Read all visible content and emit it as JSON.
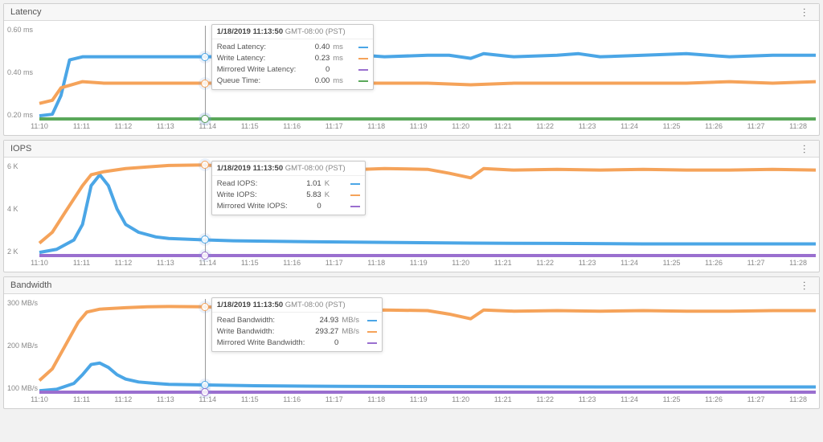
{
  "timestamp": {
    "bold": "1/18/2019 11:13:50",
    "tz": "GMT-08:00 (PST)"
  },
  "x_ticks": [
    "11:10",
    "11:11",
    "11:12",
    "11:13",
    "11:14",
    "11:15",
    "11:16",
    "11:17",
    "11:18",
    "11:19",
    "11:20",
    "11:21",
    "11:22",
    "11:23",
    "11:24",
    "11:25",
    "11:26",
    "11:27",
    "11:28"
  ],
  "cursor": {
    "minute": 13.833,
    "range_start": 10,
    "range_end": 28
  },
  "panels": {
    "latency": {
      "title": "Latency",
      "y_ticks": [
        "0.60 ms",
        "0.40 ms",
        "0.20 ms"
      ],
      "tooltip_rows": [
        {
          "label": "Read Latency:",
          "value": "0.40",
          "unit": "ms",
          "color": "#4ba6e6"
        },
        {
          "label": "Write Latency:",
          "value": "0.23",
          "unit": "ms",
          "color": "#f5a35a"
        },
        {
          "label": "Mirrored Write Latency:",
          "value": "0",
          "unit": "",
          "color": "#9a6fcf"
        },
        {
          "label": "Queue Time:",
          "value": "0.00",
          "unit": "ms",
          "color": "#5aa85a"
        }
      ]
    },
    "iops": {
      "title": "IOPS",
      "y_ticks": [
        "6 K",
        "4 K",
        "2 K"
      ],
      "tooltip_rows": [
        {
          "label": "Read IOPS:",
          "value": "1.01",
          "unit": "K",
          "color": "#4ba6e6"
        },
        {
          "label": "Write IOPS:",
          "value": "5.83",
          "unit": "K",
          "color": "#f5a35a"
        },
        {
          "label": "Mirrored Write IOPS:",
          "value": "0",
          "unit": "",
          "color": "#9a6fcf"
        }
      ]
    },
    "bandwidth": {
      "title": "Bandwidth",
      "y_ticks": [
        "300 MB/s",
        "200 MB/s",
        "100 MB/s"
      ],
      "tooltip_rows": [
        {
          "label": "Read Bandwidth:",
          "value": "24.93",
          "unit": "MB/s",
          "color": "#4ba6e6"
        },
        {
          "label": "Write Bandwidth:",
          "value": "293.27",
          "unit": "MB/s",
          "color": "#f5a35a"
        },
        {
          "label": "Mirrored Write Bandwidth:",
          "value": "0",
          "unit": "",
          "color": "#9a6fcf"
        }
      ]
    }
  },
  "chart_data": [
    {
      "title": "Latency",
      "type": "line",
      "x_range": [
        10,
        28
      ],
      "y_range": [
        0,
        0.6
      ],
      "y_unit": "ms",
      "series": [
        {
          "name": "Read Latency",
          "color": "#4ba6e6",
          "values": [
            [
              10,
              0.02
            ],
            [
              10.3,
              0.03
            ],
            [
              10.5,
              0.15
            ],
            [
              10.7,
              0.38
            ],
            [
              11,
              0.4
            ],
            [
              11.5,
              0.4
            ],
            [
              12,
              0.4
            ],
            [
              13,
              0.4
            ],
            [
              13.83,
              0.4
            ],
            [
              14,
              0.4
            ],
            [
              15,
              0.4
            ],
            [
              16,
              0.4
            ],
            [
              17,
              0.4
            ],
            [
              17.5,
              0.41
            ],
            [
              18,
              0.4
            ],
            [
              19,
              0.41
            ],
            [
              19.5,
              0.41
            ],
            [
              20,
              0.39
            ],
            [
              20.3,
              0.42
            ],
            [
              21,
              0.4
            ],
            [
              22,
              0.41
            ],
            [
              22.5,
              0.42
            ],
            [
              23,
              0.4
            ],
            [
              24,
              0.41
            ],
            [
              25,
              0.42
            ],
            [
              26,
              0.4
            ],
            [
              27,
              0.41
            ],
            [
              28,
              0.41
            ]
          ]
        },
        {
          "name": "Write Latency",
          "color": "#f5a35a",
          "values": [
            [
              10,
              0.1
            ],
            [
              10.3,
              0.12
            ],
            [
              10.5,
              0.2
            ],
            [
              11,
              0.24
            ],
            [
              11.5,
              0.23
            ],
            [
              12,
              0.23
            ],
            [
              13,
              0.23
            ],
            [
              13.83,
              0.23
            ],
            [
              15,
              0.23
            ],
            [
              17,
              0.23
            ],
            [
              19,
              0.23
            ],
            [
              20,
              0.22
            ],
            [
              21,
              0.23
            ],
            [
              23,
              0.23
            ],
            [
              25,
              0.23
            ],
            [
              26,
              0.24
            ],
            [
              27,
              0.23
            ],
            [
              28,
              0.24
            ]
          ]
        },
        {
          "name": "Mirrored Write Latency",
          "color": "#9a6fcf",
          "values": [
            [
              10,
              0
            ],
            [
              28,
              0
            ]
          ]
        },
        {
          "name": "Queue Time",
          "color": "#5aa85a",
          "values": [
            [
              10,
              0
            ],
            [
              28,
              0
            ]
          ]
        }
      ]
    },
    {
      "title": "IOPS",
      "type": "line",
      "x_range": [
        10,
        28
      ],
      "y_range": [
        0,
        6
      ],
      "y_unit": "K",
      "series": [
        {
          "name": "Read IOPS",
          "color": "#4ba6e6",
          "values": [
            [
              10,
              0.2
            ],
            [
              10.4,
              0.4
            ],
            [
              10.8,
              1.0
            ],
            [
              11.0,
              2.0
            ],
            [
              11.2,
              4.5
            ],
            [
              11.4,
              5.2
            ],
            [
              11.6,
              4.5
            ],
            [
              11.8,
              3.0
            ],
            [
              12.0,
              2.0
            ],
            [
              12.3,
              1.5
            ],
            [
              12.7,
              1.2
            ],
            [
              13,
              1.1
            ],
            [
              13.83,
              1.01
            ],
            [
              14.5,
              0.95
            ],
            [
              16,
              0.9
            ],
            [
              18,
              0.85
            ],
            [
              20,
              0.8
            ],
            [
              22,
              0.78
            ],
            [
              24,
              0.75
            ],
            [
              26,
              0.75
            ],
            [
              28,
              0.75
            ]
          ]
        },
        {
          "name": "Write IOPS",
          "color": "#f5a35a",
          "values": [
            [
              10,
              0.8
            ],
            [
              10.3,
              1.5
            ],
            [
              10.6,
              2.8
            ],
            [
              11.0,
              4.5
            ],
            [
              11.2,
              5.2
            ],
            [
              11.5,
              5.4
            ],
            [
              12,
              5.6
            ],
            [
              12.5,
              5.7
            ],
            [
              13,
              5.8
            ],
            [
              13.83,
              5.83
            ],
            [
              14.5,
              5.7
            ],
            [
              15,
              5.6
            ],
            [
              15.5,
              5.5
            ],
            [
              16,
              5.6
            ],
            [
              16.5,
              5.65
            ],
            [
              17,
              5.5
            ],
            [
              18,
              5.6
            ],
            [
              19,
              5.55
            ],
            [
              19.5,
              5.3
            ],
            [
              20,
              5.0
            ],
            [
              20.3,
              5.6
            ],
            [
              21,
              5.5
            ],
            [
              22,
              5.55
            ],
            [
              23,
              5.5
            ],
            [
              24,
              5.55
            ],
            [
              25,
              5.5
            ],
            [
              26,
              5.5
            ],
            [
              27,
              5.55
            ],
            [
              28,
              5.5
            ]
          ]
        },
        {
          "name": "Mirrored Write IOPS",
          "color": "#9a6fcf",
          "values": [
            [
              10,
              0
            ],
            [
              28,
              0
            ]
          ]
        }
      ]
    },
    {
      "title": "Bandwidth",
      "type": "line",
      "x_range": [
        10,
        28
      ],
      "y_range": [
        0,
        320
      ],
      "y_unit": "MB/s",
      "series": [
        {
          "name": "Read Bandwidth",
          "color": "#4ba6e6",
          "values": [
            [
              10,
              5
            ],
            [
              10.4,
              10
            ],
            [
              10.8,
              30
            ],
            [
              11.0,
              60
            ],
            [
              11.2,
              95
            ],
            [
              11.4,
              100
            ],
            [
              11.6,
              85
            ],
            [
              11.8,
              60
            ],
            [
              12.0,
              45
            ],
            [
              12.3,
              35
            ],
            [
              12.7,
              30
            ],
            [
              13,
              27
            ],
            [
              13.83,
              24.93
            ],
            [
              15,
              22
            ],
            [
              17,
              20
            ],
            [
              20,
              19
            ],
            [
              23,
              18
            ],
            [
              26,
              18
            ],
            [
              28,
              18
            ]
          ]
        },
        {
          "name": "Write Bandwidth",
          "color": "#f5a35a",
          "values": [
            [
              10,
              40
            ],
            [
              10.3,
              80
            ],
            [
              10.6,
              160
            ],
            [
              10.9,
              240
            ],
            [
              11.1,
              275
            ],
            [
              11.4,
              285
            ],
            [
              12,
              290
            ],
            [
              12.5,
              293
            ],
            [
              13,
              294
            ],
            [
              13.83,
              293.27
            ],
            [
              14.5,
              288
            ],
            [
              15,
              283
            ],
            [
              15.5,
              278
            ],
            [
              16,
              282
            ],
            [
              17,
              278
            ],
            [
              18,
              282
            ],
            [
              19,
              280
            ],
            [
              19.5,
              268
            ],
            [
              20,
              252
            ],
            [
              20.3,
              282
            ],
            [
              21,
              278
            ],
            [
              22,
              280
            ],
            [
              23,
              278
            ],
            [
              24,
              280
            ],
            [
              25,
              278
            ],
            [
              26,
              278
            ],
            [
              27,
              280
            ],
            [
              28,
              280
            ]
          ]
        },
        {
          "name": "Mirrored Write Bandwidth",
          "color": "#9a6fcf",
          "values": [
            [
              10,
              0
            ],
            [
              28,
              0
            ]
          ]
        }
      ]
    }
  ]
}
